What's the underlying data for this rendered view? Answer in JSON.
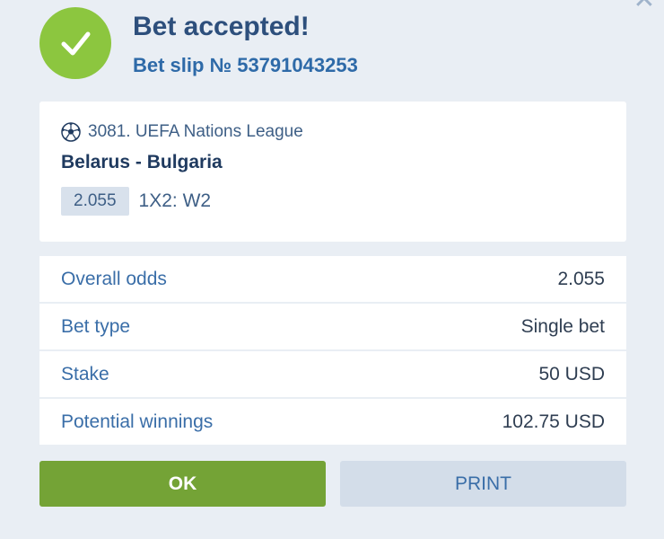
{
  "colors": {
    "success_green": "#8cc63f",
    "ok_button": "#74a336",
    "print_button": "#d3dde9",
    "title_blue": "#2d4f7c",
    "link_blue": "#3a6ea8",
    "background": "#e9eef4"
  },
  "header": {
    "icon": "check-circle-icon",
    "title": "Bet accepted!",
    "slip_number": "Bet slip № 53791043253",
    "close_icon": "close-icon"
  },
  "event": {
    "sport_icon": "soccer-ball-icon",
    "league": "3081. UEFA Nations League",
    "match": "Belarus - Bulgaria",
    "odds": "2.055",
    "market": "1X2: W2"
  },
  "summary": [
    {
      "label": "Overall odds",
      "value": "2.055"
    },
    {
      "label": "Bet type",
      "value": "Single bet"
    },
    {
      "label": "Stake",
      "value": "50 USD"
    },
    {
      "label": "Potential winnings",
      "value": "102.75 USD"
    }
  ],
  "actions": {
    "ok_label": "OK",
    "print_label": "PRINT"
  }
}
